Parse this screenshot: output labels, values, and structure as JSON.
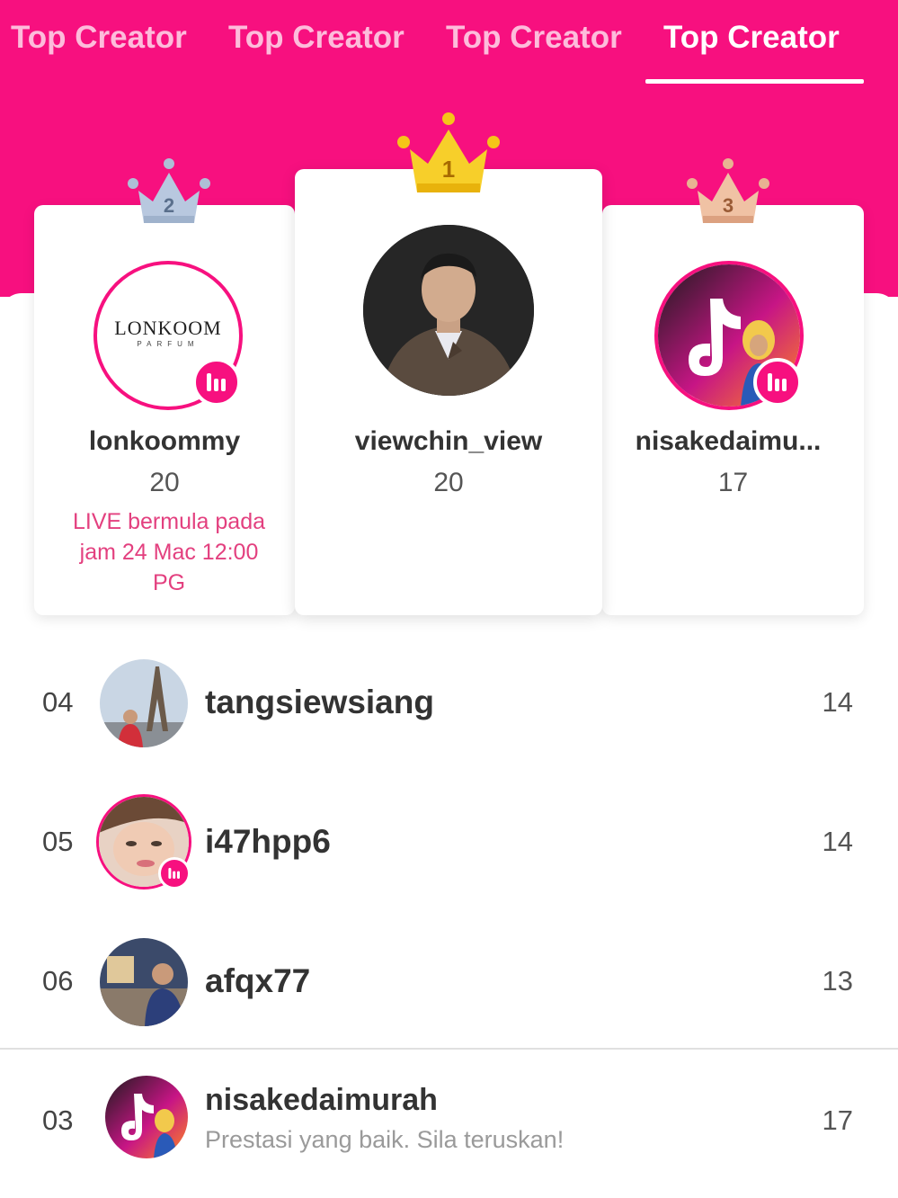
{
  "tabs": [
    {
      "label": "Top Creator",
      "active": false
    },
    {
      "label": "Top Creator",
      "active": false
    },
    {
      "label": "Top Creator",
      "active": false
    },
    {
      "label": "Top Creator",
      "active": true
    }
  ],
  "colors": {
    "brand": "#f7107f",
    "gold": "#f5c518",
    "silver": "#aebfd6",
    "bronze": "#e8b392",
    "live_text": "#e3407f"
  },
  "podium": [
    {
      "rank": "2",
      "name": "lonkoommy",
      "score": "20",
      "avatar_text": "LONKOOM",
      "avatar_subtext": "PARFUM",
      "live": true,
      "live_note": "LIVE bermula pada jam 24 Mac 12:00 PG"
    },
    {
      "rank": "1",
      "name": "viewchin_view",
      "score": "20",
      "live": false
    },
    {
      "rank": "3",
      "name": "nisakedaimu...",
      "score": "17",
      "live": true
    }
  ],
  "list": [
    {
      "rank": "04",
      "name": "tangsiewsiang",
      "score": "14",
      "live": false
    },
    {
      "rank": "05",
      "name": "i47hpp6",
      "score": "14",
      "live": true
    },
    {
      "rank": "06",
      "name": "afqx77",
      "score": "13",
      "live": false
    }
  ],
  "self_row": {
    "rank": "03",
    "name": "nisakedaimurah",
    "subtitle": "Prestasi yang baik. Sila teruskan!",
    "score": "17"
  }
}
